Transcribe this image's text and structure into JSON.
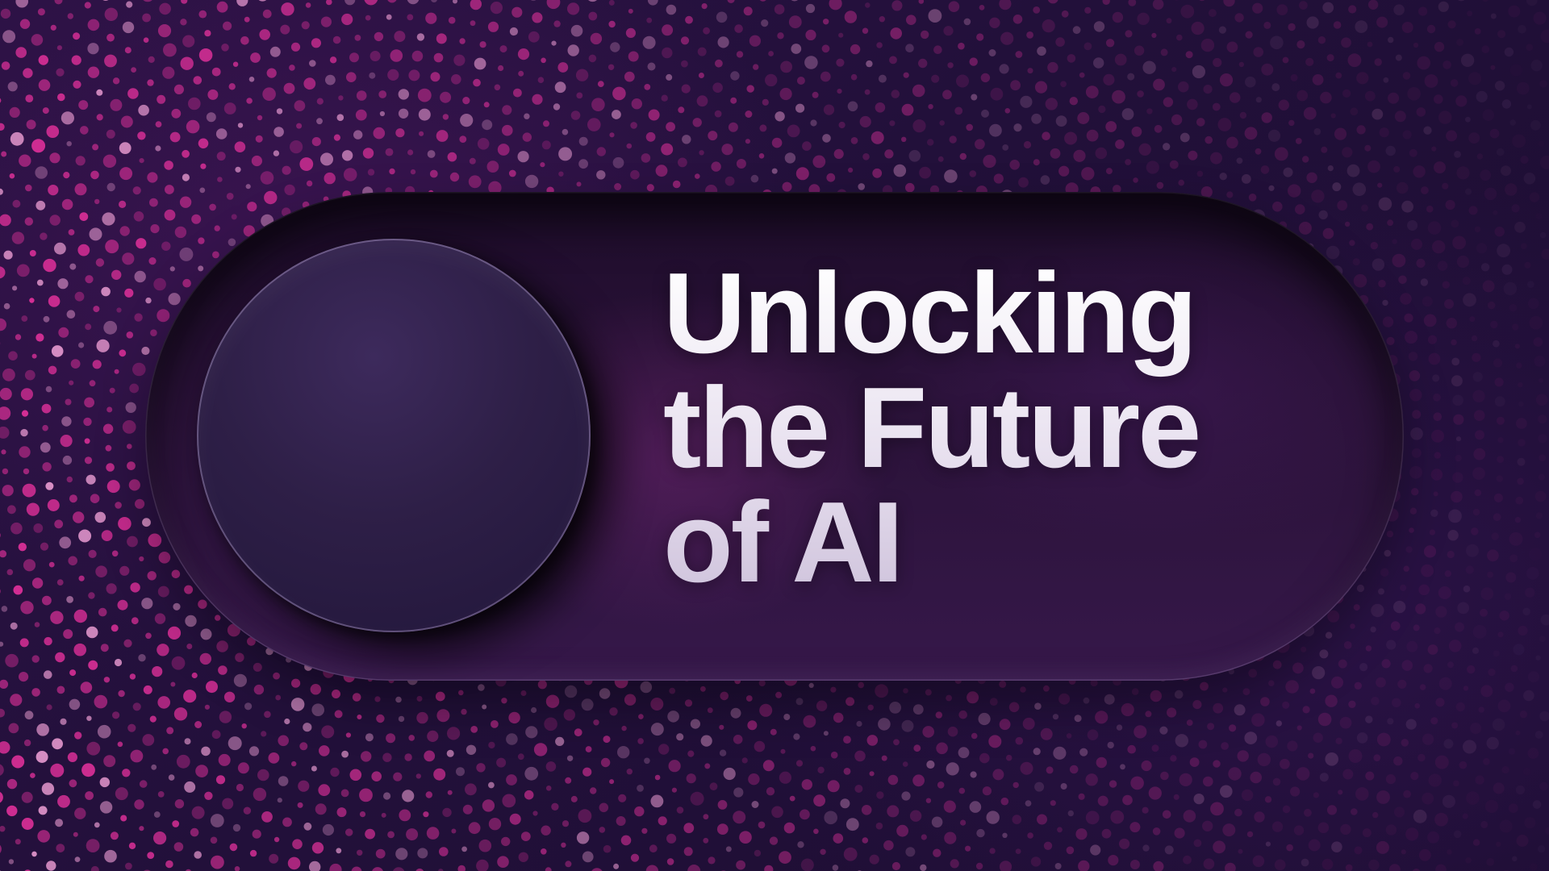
{
  "headline": {
    "line1": "Unlocking",
    "line2": "the Future",
    "line3": "of AI"
  },
  "toggle": {
    "state": "off"
  },
  "colors": {
    "background": "#22103a",
    "dot_accent": "#e0309a",
    "dot_light": "#e89ad0",
    "track": "#2a1238",
    "knob": "#2e1f47",
    "text": "#ece6f2"
  }
}
